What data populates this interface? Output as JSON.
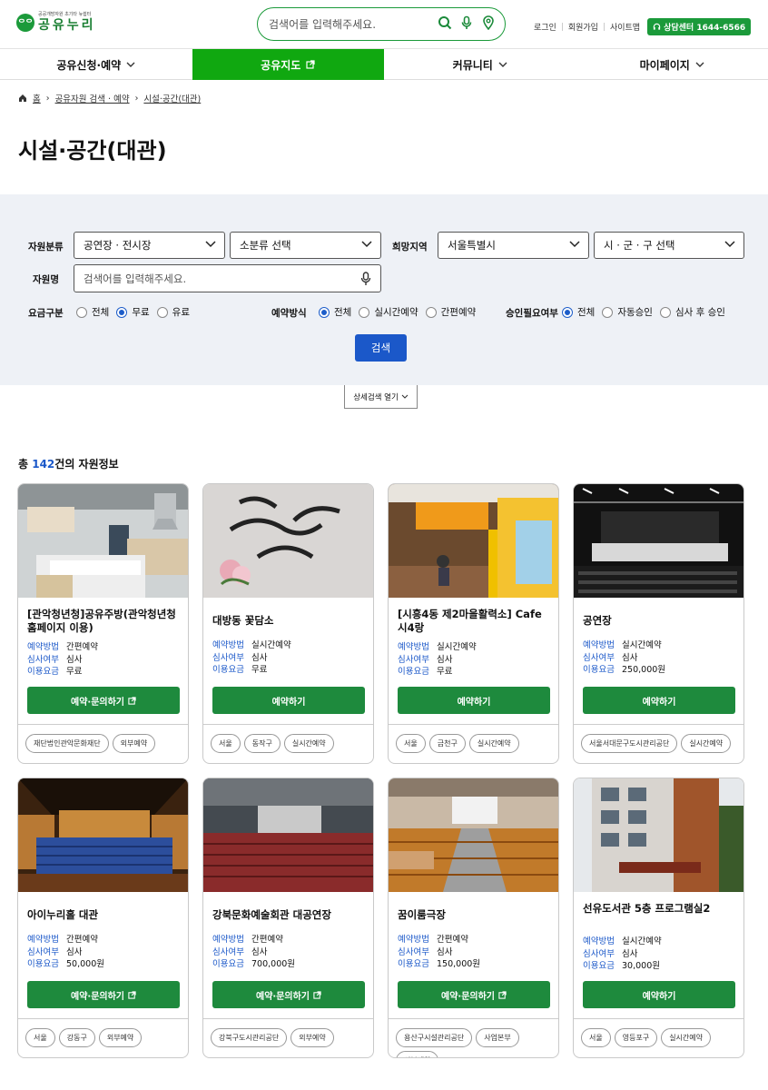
{
  "header": {
    "logo_mark": "ᄋᄋ",
    "logo_sub": "공공개방자원 초기타 뉴쉼터",
    "logo_name": "공유누리",
    "search_placeholder": "검색어를 입력해주세요.",
    "util": [
      "로그인",
      "회원가입",
      "사이트맵"
    ],
    "callcenter": "상담센터 1644-6566"
  },
  "gnb": [
    {
      "label": "공유신청·예약",
      "active": false
    },
    {
      "label": "공유지도",
      "active": true
    },
    {
      "label": "커뮤니티",
      "active": false
    },
    {
      "label": "마이페이지",
      "active": false
    }
  ],
  "breadcrumb": [
    "홈",
    "공유자원 검색 · 예약",
    "시설·공간(대관)"
  ],
  "page_title": "시설·공간(대관)",
  "filter": {
    "category_label": "자원분류",
    "category_main": "공연장 · 전시장",
    "category_sub": "소분류 선택",
    "region_label": "희망지역",
    "region_main": "서울특별시",
    "region_sub": "시 · 군 · 구 선택",
    "name_label": "자원명",
    "name_placeholder": "검색어를 입력해주세요.",
    "fee_label": "요금구분",
    "fee_options": [
      "전체",
      "무료",
      "유료"
    ],
    "fee_selected": 1,
    "reserve_label": "예약방식",
    "reserve_options": [
      "전체",
      "실시간예약",
      "간편예약"
    ],
    "reserve_selected": 0,
    "approval_label": "승인필요여부",
    "approval_options": [
      "전체",
      "자동승인",
      "심사 후 승인"
    ],
    "approval_selected": 0,
    "search_button": "검색",
    "detail_button": "상세검색 열기"
  },
  "total": {
    "prefix": "총 ",
    "count": "142",
    "suffix": "건의 자원정보"
  },
  "meta_keys": {
    "method": "예약방법",
    "review": "심사여부",
    "fee": "이용요금"
  },
  "cards": [
    {
      "title": "[관악청년청]공유주방(관악청년청 홈페이지 이용)",
      "method": "간편예약",
      "review": "심사",
      "fee": "무료",
      "button": "예약·문의하기",
      "external": true,
      "tags": [
        "재단법인관악문화재단",
        "외부예약"
      ]
    },
    {
      "title": "대방동 꽃담소",
      "method": "실시간예약",
      "review": "심사",
      "fee": "무료",
      "button": "예약하기",
      "external": false,
      "tags": [
        "서울",
        "동작구",
        "실시간예약"
      ]
    },
    {
      "title": "[시흥4동 제2마을활력소] Cafe 시4랑",
      "method": "실시간예약",
      "review": "심사",
      "fee": "무료",
      "button": "예약하기",
      "external": false,
      "tags": [
        "서울",
        "금천구",
        "실시간예약"
      ]
    },
    {
      "title": "공연장",
      "method": "실시간예약",
      "review": "심사",
      "fee": "250,000원",
      "button": "예약하기",
      "external": false,
      "tags": [
        "서울서대문구도시관리공단",
        "실시간예약"
      ]
    },
    {
      "title": "아이누리홀 대관",
      "method": "간편예약",
      "review": "심사",
      "fee": "50,000원",
      "button": "예약·문의하기",
      "external": true,
      "tags": [
        "서울",
        "강동구",
        "외부예약"
      ]
    },
    {
      "title": "강북문화예술회관 대공연장",
      "method": "간편예약",
      "review": "심사",
      "fee": "700,000원",
      "button": "예약·문의하기",
      "external": true,
      "tags": [
        "강북구도시관리공단",
        "외부예약"
      ]
    },
    {
      "title": "꿈이룸극장",
      "method": "간편예약",
      "review": "심사",
      "fee": "150,000원",
      "button": "예약·문의하기",
      "external": true,
      "tags": [
        "용산구시설관리공단",
        "사업본부",
        "외부예약"
      ]
    },
    {
      "title": "선유도서관 5층 프로그램실2",
      "method": "실시간예약",
      "review": "심사",
      "fee": "30,000원",
      "button": "예약하기",
      "external": false,
      "tags": [
        "서울",
        "영등포구",
        "실시간예약"
      ]
    }
  ]
}
